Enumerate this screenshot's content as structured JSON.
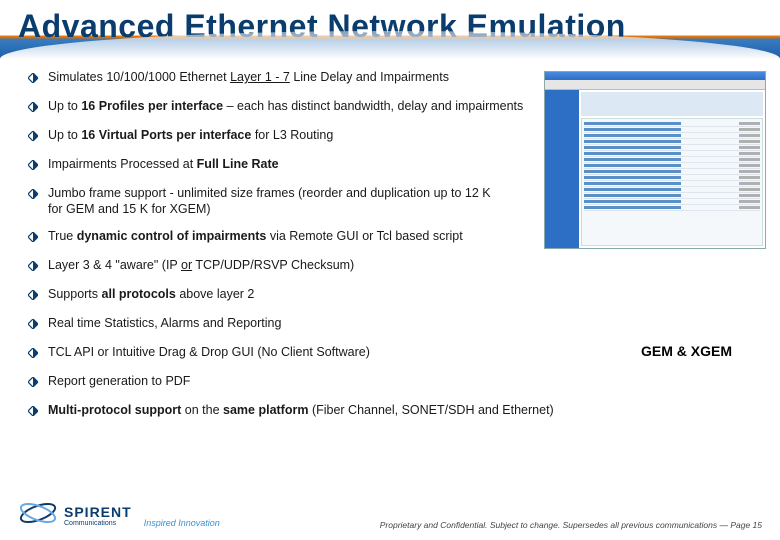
{
  "title": "Advanced Ethernet Network Emulation",
  "bullets": {
    "b0_pre": "Simulates 10/100/1000 Ethernet ",
    "b0_u1": "Layer 1 - 7",
    "b0_post": " Line Delay and Impairments",
    "b1_pre": "Up to ",
    "b1_b1": "16 Profiles per interface",
    "b1_post": " – each has distinct bandwidth, delay and impairments",
    "b2_pre": "Up to ",
    "b2_b1": "16 Virtual Ports per interface",
    "b2_post": " for L3 Routing",
    "b3_pre": "Impairments Processed at ",
    "b3_b1": "Full Line Rate",
    "b4": "Jumbo frame support - unlimited size frames (reorder and duplication up to 12 K for GEM and 15 K for XGEM)",
    "b5_pre": "True ",
    "b5_b1": "dynamic control of impairments",
    "b5_post": " via Remote GUI or Tcl based script",
    "b6_pre": "Layer 3 & 4 \"aware\" (IP ",
    "b6_u1": "or",
    "b6_post": " TCP/UDP/RSVP Checksum)",
    "b7_pre": "Supports ",
    "b7_b1": "all protocols",
    "b7_post": " above layer 2",
    "b8": "Real time Statistics, Alarms and Reporting",
    "b9": "TCL API or Intuitive Drag & Drop GUI (No Client Software)",
    "b10": "Report generation to PDF",
    "b11_b1": "Multi-protocol support",
    "b11_mid": " on the ",
    "b11_b2": "same platform",
    "b11_post": " (Fiber Channel, SONET/SDH and Ethernet)"
  },
  "caption": "GEM & XGEM",
  "logo": {
    "name": "SPIRENT",
    "sub": "Communications",
    "tagline": "Inspired Innovation"
  },
  "footer_note": "Proprietary and Confidential. Subject to change. Supersedes all previous communications — Page 15"
}
